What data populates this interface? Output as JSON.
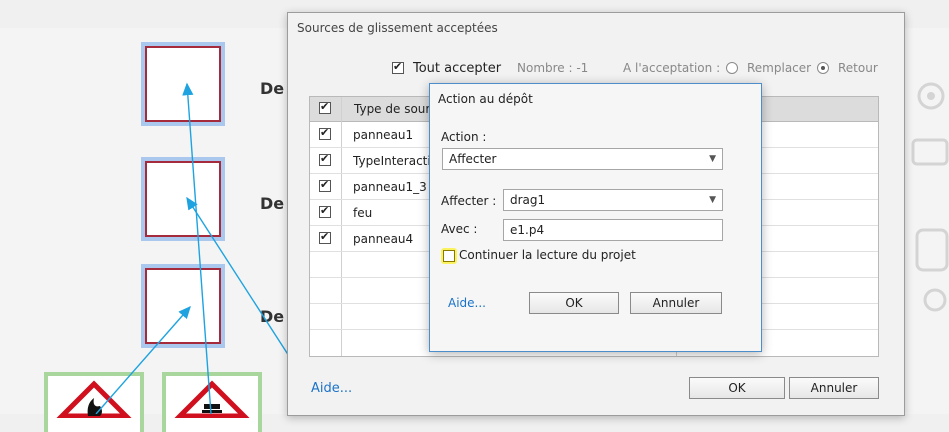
{
  "main_dialog": {
    "title": "Sources de glissement acceptées",
    "accept_all_label": "Tout accepter",
    "count_label": "Nombre : -1",
    "on_accept_label": "A l'acceptation :",
    "replace_label": "Remplacer",
    "back_label": "Retour",
    "column_header": "Type de source",
    "rows": [
      "panneau1",
      "TypeInteraction",
      "panneau1_3",
      "feu",
      "panneau4"
    ],
    "help_link": "Aide...",
    "ok_label": "OK",
    "cancel_label": "Annuler"
  },
  "drop_dialog": {
    "title": "Action au dépôt",
    "action_label": "Action :",
    "action_value": "Affecter",
    "assign_label": "Affecter :",
    "assign_value": "drag1",
    "with_label": "Avec :",
    "with_value": "e1.p4",
    "continue_label": "Continuer la lecture du projet",
    "help_link": "Aide...",
    "ok_label": "OK",
    "cancel_label": "Annuler"
  },
  "canvas": {
    "target_labels": [
      "De l",
      "De l",
      "De l"
    ]
  },
  "colors": {
    "arrow": "#1ea3e0",
    "target_border": "#a52a3c",
    "target_halo": "#aac8ee",
    "source_frame": "#a8d69c",
    "link": "#1a73c9",
    "highlight": "#fbf25f"
  }
}
